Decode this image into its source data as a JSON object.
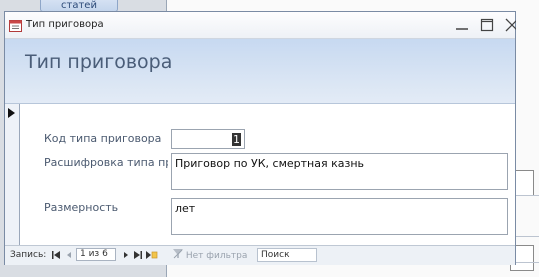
{
  "background": {
    "top_button_label": "статей"
  },
  "window": {
    "title": "Тип приговора",
    "controls": [
      "minimize",
      "maximize",
      "close"
    ]
  },
  "form": {
    "title": "Тип приговора",
    "fields": [
      {
        "label": "Код типа приговора",
        "value": "1"
      },
      {
        "label": "Расшифровка типа при",
        "value": "Приговор по УК, смертная казнь"
      },
      {
        "label": "Размерность",
        "value": "лет"
      }
    ]
  },
  "nav": {
    "record_label": "Запись:",
    "record_position": "1 из 6",
    "filter_label": "Нет фильтра",
    "search_label": "Поиск"
  },
  "colors": {
    "header_band": "#c7d9f1",
    "form_title": "#4a5d78",
    "label_text": "#4b5a70"
  }
}
